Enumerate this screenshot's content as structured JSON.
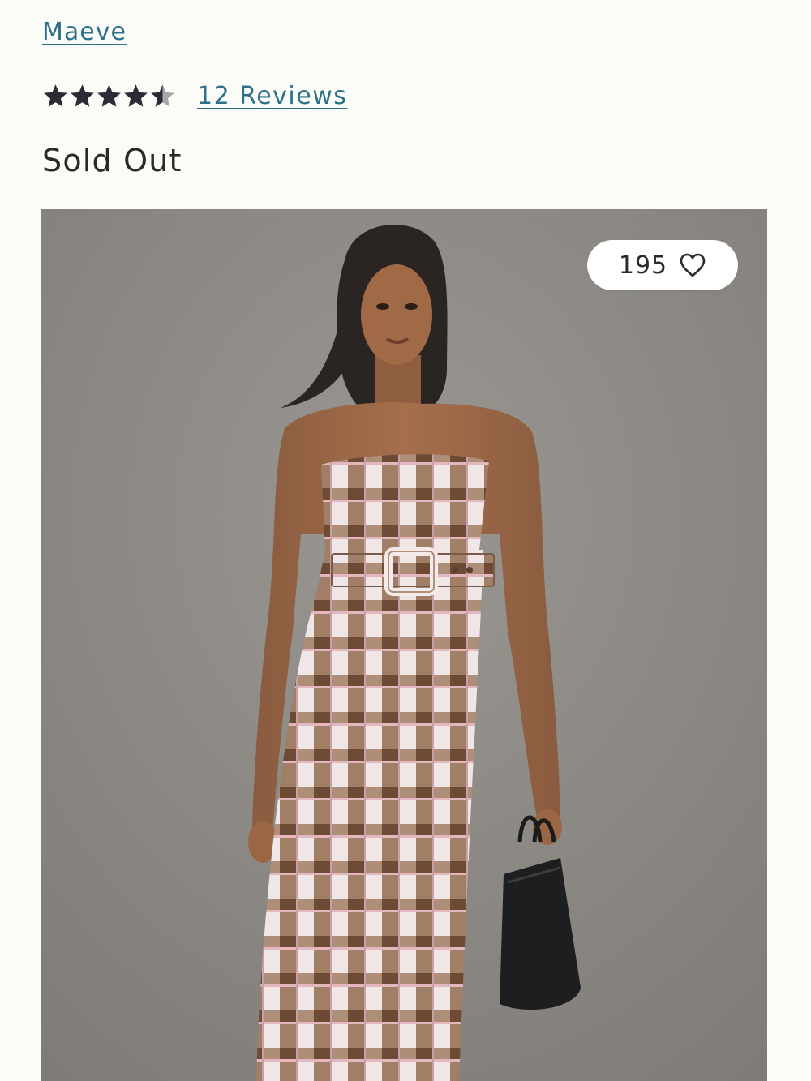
{
  "product": {
    "brand": "Maeve",
    "rating": 4.5,
    "rating_max": 5,
    "reviews_label": "12 Reviews",
    "availability": "Sold Out"
  },
  "image": {
    "description_icon": "product-photo",
    "like_count": "195",
    "like_icon": "heart-outline-icon"
  },
  "colors": {
    "link": "#2c7089",
    "star_filled": "#2b2b35",
    "star_empty": "#a7a7a7",
    "photo_background": "#8d8a86"
  }
}
